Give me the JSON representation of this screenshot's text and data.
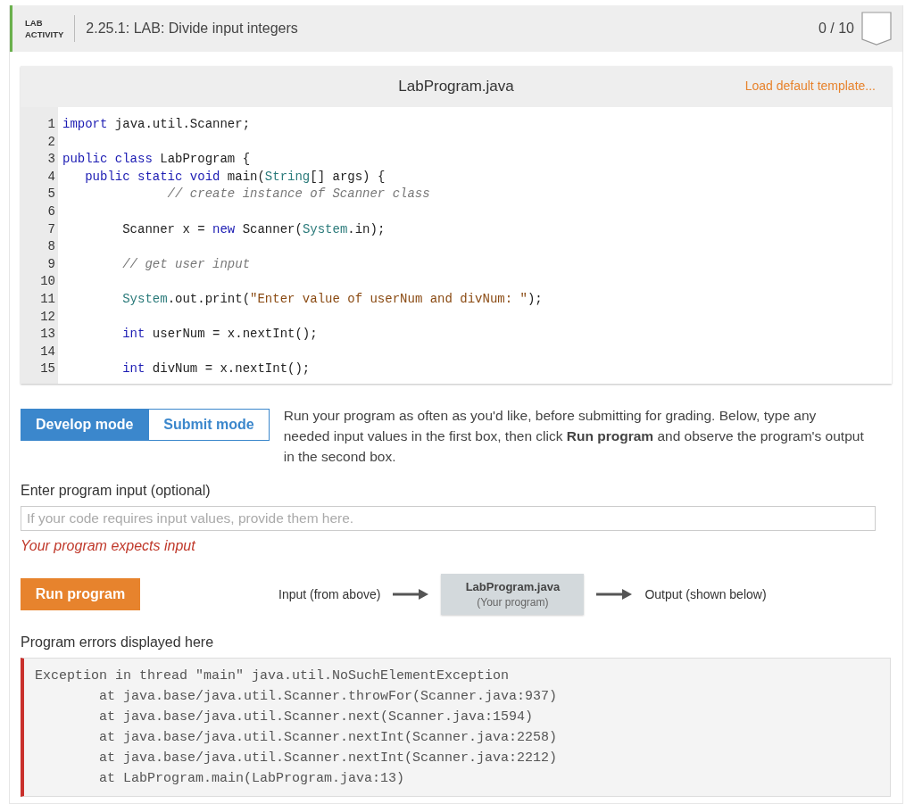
{
  "header": {
    "badge_line_1": "LAB",
    "badge_line_2": "ACTIVITY",
    "title": "2.25.1: LAB: Divide input integers",
    "score": "0 / 10"
  },
  "editor": {
    "filename": "LabProgram.java",
    "load_template": "Load default template...",
    "lines": [
      {
        "number": "1",
        "tokens": [
          {
            "kind": "keyword",
            "text": "import"
          },
          {
            "kind": "plain",
            "text": " java.util.Scanner;"
          }
        ]
      },
      {
        "number": "2"
      },
      {
        "number": "3",
        "tokens": [
          {
            "kind": "keyword",
            "text": "public class"
          },
          {
            "kind": "plain",
            "text": " LabProgram {"
          }
        ]
      },
      {
        "number": "4",
        "tokens": [
          {
            "kind": "keyword",
            "text": "   public static void"
          },
          {
            "kind": "plain",
            "text": " main("
          },
          {
            "kind": "type",
            "text": "String"
          },
          {
            "kind": "plain",
            "text": "[] args) {"
          }
        ]
      },
      {
        "number": "5",
        "tokens": [
          {
            "kind": "comment",
            "text": "              // create instance of Scanner class"
          }
        ]
      },
      {
        "number": "6"
      },
      {
        "number": "7",
        "tokens": [
          {
            "kind": "plain",
            "text": "        Scanner x = "
          },
          {
            "kind": "keyword",
            "text": "new"
          },
          {
            "kind": "plain",
            "text": " Scanner("
          },
          {
            "kind": "type",
            "text": "System"
          },
          {
            "kind": "plain",
            "text": ".in);"
          }
        ]
      },
      {
        "number": "8"
      },
      {
        "number": "9",
        "tokens": [
          {
            "kind": "comment",
            "text": "        // get user input"
          }
        ]
      },
      {
        "number": "10"
      },
      {
        "number": "11",
        "tokens": [
          {
            "kind": "type",
            "text": "        System"
          },
          {
            "kind": "plain",
            "text": ".out.print("
          },
          {
            "kind": "string",
            "text": "\"Enter value of userNum and divNum: \""
          },
          {
            "kind": "plain",
            "text": ");"
          }
        ]
      },
      {
        "number": "12"
      },
      {
        "number": "13",
        "tokens": [
          {
            "kind": "keyword",
            "text": "        int"
          },
          {
            "kind": "plain",
            "text": " userNum = x.nextInt();"
          }
        ]
      },
      {
        "number": "14"
      },
      {
        "number": "15",
        "tokens": [
          {
            "kind": "keyword",
            "text": "        int"
          },
          {
            "kind": "plain",
            "text": " divNum = x.nextInt();"
          }
        ]
      }
    ]
  },
  "modes": [
    {
      "label": "Develop mode",
      "selected": true
    },
    {
      "label": "Submit mode",
      "selected": false
    }
  ],
  "instructions": "Run your program as often as you'd like, before submitting for grading. Below, type any needed input values in the first box, then click **Run program** and observe the program's output in the second box.",
  "input": {
    "label": "Enter program input (optional)",
    "placeholder": "If your code requires input values, provide them here.",
    "warning": "Your program expects input"
  },
  "run": {
    "button": "Run program",
    "input_label": "Input (from above)",
    "program_name": "LabProgram.java",
    "program_caption": "(Your program)",
    "output_label": "Output (shown below)"
  },
  "errors": {
    "label": "Program errors displayed here",
    "lines": [
      "Exception in thread \"main\" java.util.NoSuchElementException",
      "        at java.base/java.util.Scanner.throwFor(Scanner.java:937)",
      "        at java.base/java.util.Scanner.next(Scanner.java:1594)",
      "        at java.base/java.util.Scanner.nextInt(Scanner.java:2258)",
      "        at java.base/java.util.Scanner.nextInt(Scanner.java:2212)",
      "        at LabProgram.main(LabProgram.java:13)"
    ]
  }
}
